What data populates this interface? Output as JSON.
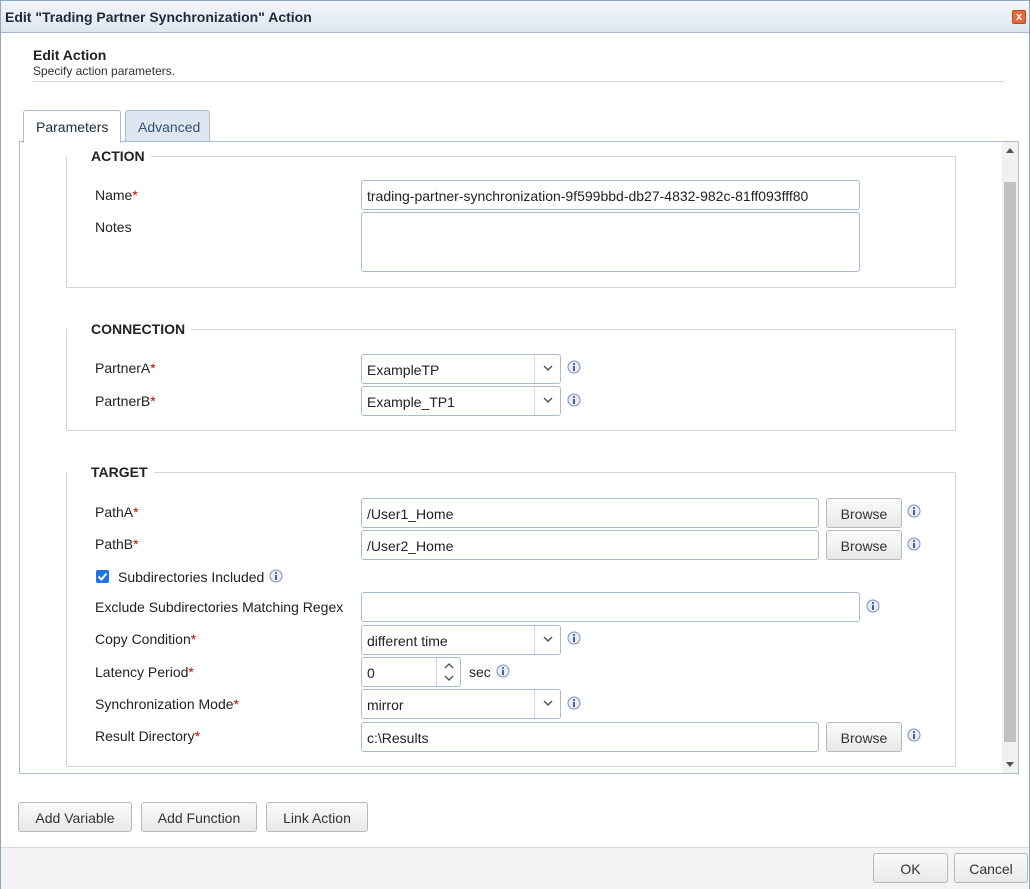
{
  "window": {
    "title": "Edit \"Trading Partner Synchronization\" Action",
    "close_label": "x"
  },
  "header": {
    "title": "Edit Action",
    "subtitle": "Specify action parameters."
  },
  "tabs": [
    {
      "label": "Parameters",
      "active": true
    },
    {
      "label": "Advanced",
      "active": false
    }
  ],
  "sections": {
    "action": {
      "title": "ACTION",
      "name_label": "Name",
      "name_value": "trading-partner-synchronization-9f599bbd-db27-4832-982c-81ff093fff80",
      "notes_label": "Notes",
      "notes_value": ""
    },
    "connection": {
      "title": "CONNECTION",
      "partner_a_label": "PartnerA",
      "partner_a_value": "ExampleTP",
      "partner_b_label": "PartnerB",
      "partner_b_value": "Example_TP1"
    },
    "target": {
      "title": "TARGET",
      "path_a_label": "PathA",
      "path_a_value": "/User1_Home",
      "path_b_label": "PathB",
      "path_b_value": "/User2_Home",
      "browse_label": "Browse",
      "subdirs_label": "Subdirectories Included",
      "subdirs_checked": true,
      "exclude_label": "Exclude Subdirectories Matching Regex",
      "exclude_value": "",
      "copy_condition_label": "Copy Condition",
      "copy_condition_value": "different time",
      "latency_label": "Latency Period",
      "latency_value": "0",
      "latency_unit": "sec",
      "sync_mode_label": "Synchronization Mode",
      "sync_mode_value": "mirror",
      "result_dir_label": "Result Directory",
      "result_dir_value": "c:\\Results"
    }
  },
  "required_marker": "*",
  "bottom_buttons": {
    "add_variable": "Add Variable",
    "add_function": "Add Function",
    "link_action": "Link Action"
  },
  "footer": {
    "ok": "OK",
    "cancel": "Cancel"
  },
  "colors": {
    "accent": "#1a73e8",
    "required": "#cc0000",
    "info_icon": "#7b8fbf"
  }
}
